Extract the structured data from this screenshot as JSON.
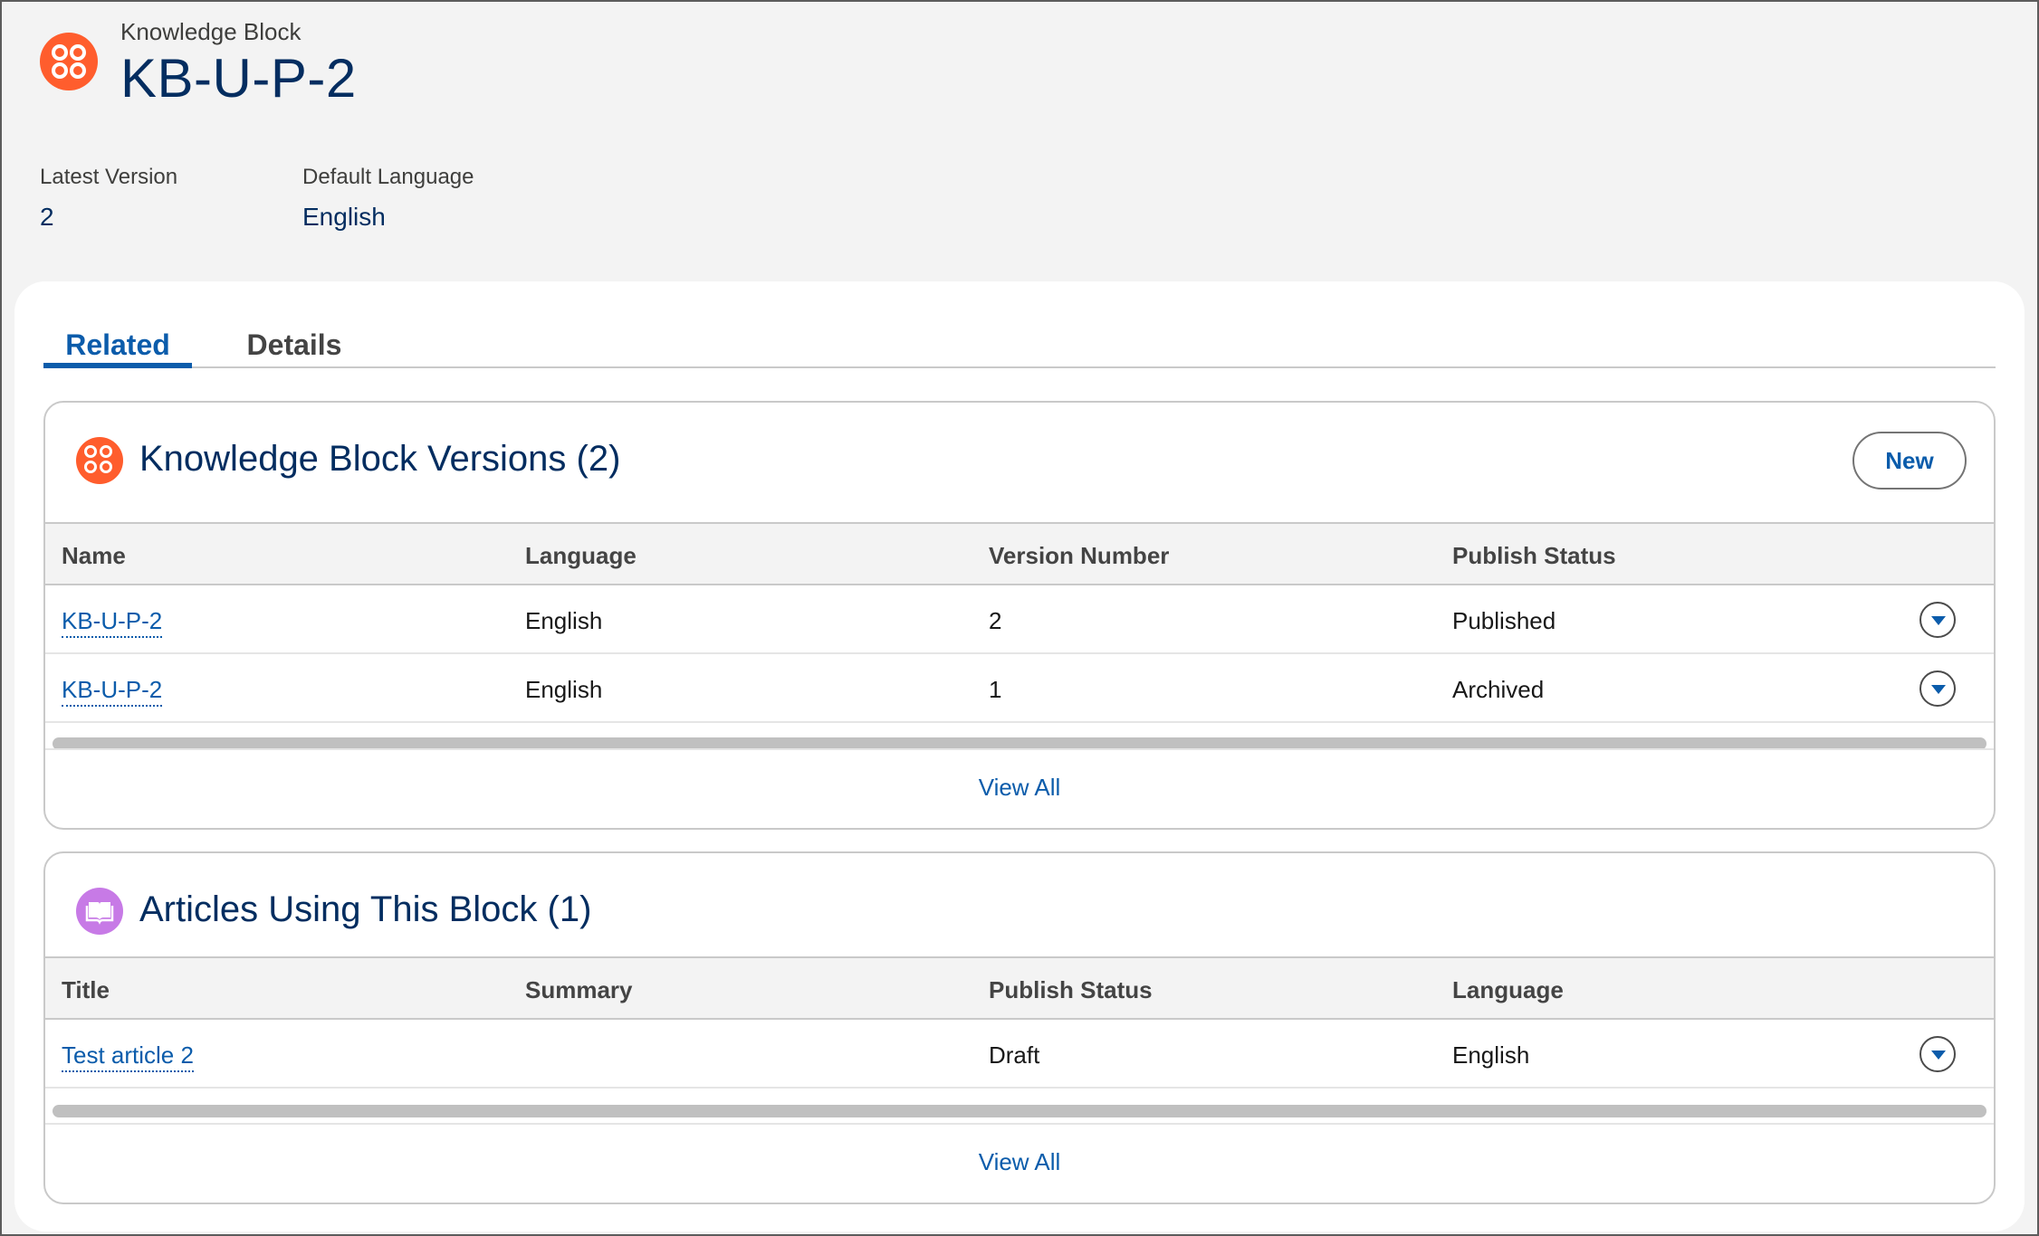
{
  "header": {
    "object_type": "Knowledge Block",
    "title": "KB-U-P-2",
    "icon": "knowledge-block-icon",
    "fields": [
      {
        "label": "Latest Version",
        "value": "2"
      },
      {
        "label": "Default Language",
        "value": "English"
      }
    ]
  },
  "tabs": [
    {
      "label": "Related",
      "active": true
    },
    {
      "label": "Details",
      "active": false
    }
  ],
  "versions": {
    "title": "Knowledge Block Versions (2)",
    "icon": "knowledge-block-icon",
    "new_label": "New",
    "columns": [
      "Name",
      "Language",
      "Version Number",
      "Publish Status"
    ],
    "rows": [
      {
        "name": "KB-U-P-2",
        "language": "English",
        "version": "2",
        "status": "Published"
      },
      {
        "name": "KB-U-P-2",
        "language": "English",
        "version": "1",
        "status": "Archived"
      }
    ],
    "view_all": "View All"
  },
  "articles": {
    "title": "Articles Using This Block (1)",
    "icon": "knowledge-book-icon",
    "columns": [
      "Title",
      "Summary",
      "Publish Status",
      "Language"
    ],
    "rows": [
      {
        "title": "Test article 2",
        "summary": "",
        "status": "Draft",
        "language": "English"
      }
    ],
    "view_all": "View All"
  },
  "colors": {
    "accent": "#0b5cab",
    "title": "#032d60",
    "block_icon": "#ff5d2d",
    "article_icon": "#c77ae6"
  }
}
